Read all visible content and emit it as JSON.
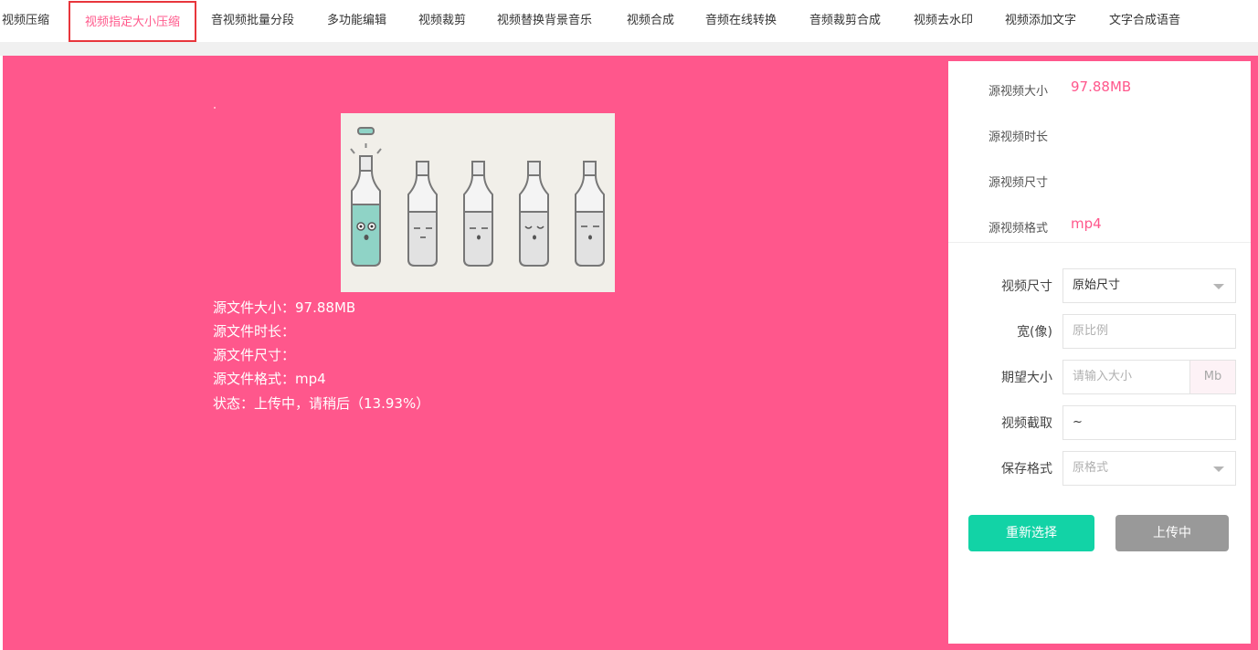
{
  "tabs": [
    {
      "label": "视频压缩"
    },
    {
      "label": "视频指定大小压缩",
      "active": true
    },
    {
      "label": "音视频批量分段"
    },
    {
      "label": "多功能编辑"
    },
    {
      "label": "视频裁剪"
    },
    {
      "label": "视频替换背景音乐"
    },
    {
      "label": "视频合成"
    },
    {
      "label": "音频在线转换"
    },
    {
      "label": "音频裁剪合成"
    },
    {
      "label": "视频去水印"
    },
    {
      "label": "视频添加文字"
    },
    {
      "label": "文字合成语音"
    }
  ],
  "file_info": {
    "size": "源文件大小：97.88MB",
    "duration": "源文件时长：",
    "dimensions": "源文件尺寸：",
    "format": "源文件格式：mp4",
    "status": "状态：上传中，请稍后（13.93%）"
  },
  "thumbnail": {
    "icon": "bottles-illustration"
  },
  "source_meta": {
    "size_label": "源视频大小",
    "size_value": "97.88MB",
    "duration_label": "源视频时长",
    "duration_value": "",
    "dimensions_label": "源视频尺寸",
    "dimensions_value": "",
    "format_label": "源视频格式",
    "format_value": "mp4"
  },
  "form": {
    "video_size_label": "视频尺寸",
    "video_size_value": "原始尺寸",
    "width_label": "宽(像)",
    "width_placeholder": "原比例",
    "target_size_label": "期望大小",
    "target_size_placeholder": "请输入大小",
    "target_size_unit": "Mb",
    "clip_label": "视频截取",
    "clip_value": "~",
    "save_format_label": "保存格式",
    "save_format_placeholder": "原格式"
  },
  "buttons": {
    "reselect": "重新选择",
    "uploading": "上传中"
  },
  "colors": {
    "accent": "#ff578c",
    "active_tab_border": "#e8363c",
    "green_button": "#12d3a6",
    "grey_button": "#999999"
  }
}
